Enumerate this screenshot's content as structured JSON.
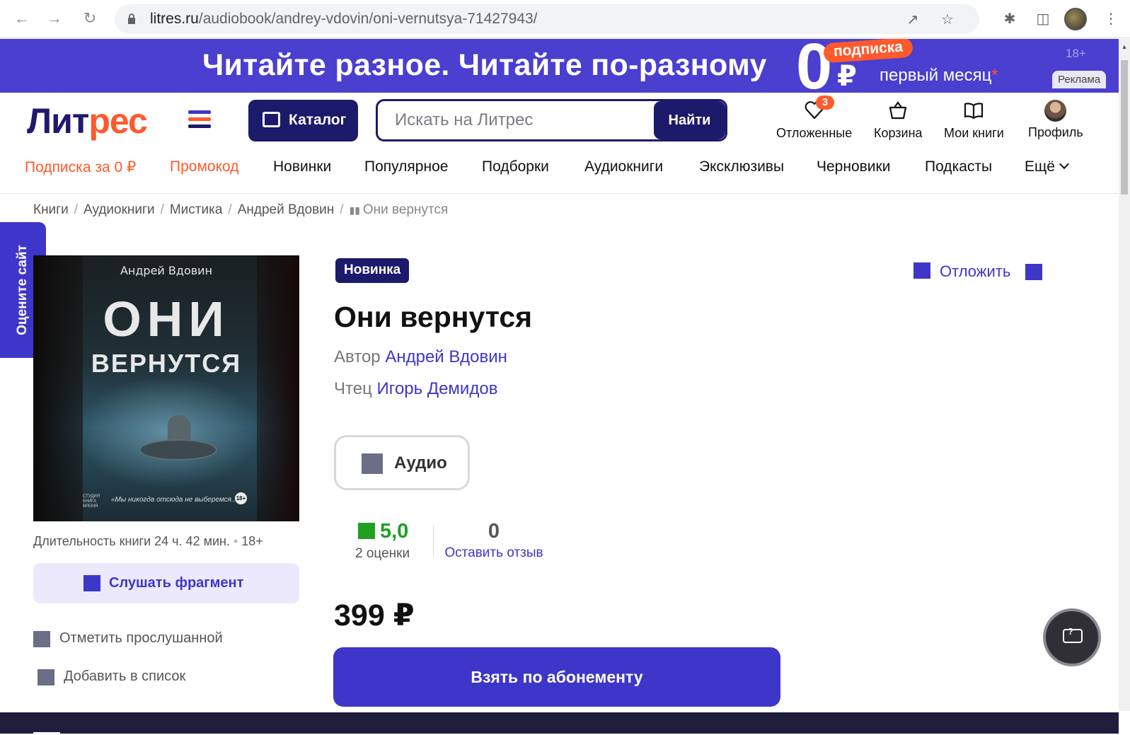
{
  "browser": {
    "url_host": "litres.ru",
    "url_path": "/audiobook/andrey-vdovin/oni-vernutsya-71427943/"
  },
  "ad": {
    "headline": "Читайте разное. Читайте по-разному",
    "zero": "0",
    "currency": "₽",
    "badge": "подписка",
    "month": "первый месяц",
    "asterisk": "*",
    "age": "18+",
    "label": "Реклама"
  },
  "header": {
    "logo_part1": "Лит",
    "logo_part2": "рес",
    "catalog": "Каталог",
    "search_placeholder": "Искать на Литрес",
    "search_button": "Найти",
    "favorites_label": "Отложенные",
    "favorites_count": "3",
    "cart_label": "Корзина",
    "mybooks_label": "Мои книги",
    "profile_label": "Профиль"
  },
  "menu": {
    "items": [
      "Подписка за 0 ₽",
      "Промокод",
      "Новинки",
      "Популярное",
      "Подборки",
      "Аудиокниги",
      "Эксклюзивы",
      "Черновики",
      "Подкасты",
      "Ещё"
    ]
  },
  "breadcrumbs": {
    "items": [
      "Книги",
      "Аудиокниги",
      "Мистика",
      "Андрей Вдовин"
    ],
    "current": "Они вернутся",
    "separator": "/"
  },
  "rate_tab": "Оцените сайт",
  "cover": {
    "author": "Андрей Вдовин",
    "title_line1": "ОНИ",
    "title_line2": "ВЕРНУТСЯ",
    "quote": "«Мы никогда отсюда не выберемся...»",
    "age": "18+",
    "publisher": "СТУДИЯ КНИГА ВРЕМЯ"
  },
  "book": {
    "duration": "Длительность книги 24 ч. 42 мин.",
    "age": "18+",
    "listen_fragment": "Слушать фрагмент",
    "mark_listened": "Отметить прослушанной",
    "add_to_list": "Добавить в список",
    "badge": "Новинка",
    "title": "Они вернутся",
    "author_label": "Автор",
    "author_name": "Андрей Вдовин",
    "reader_label": "Чтец",
    "reader_name": "Игорь Демидов",
    "postpone": "Отложить",
    "format": "Аудио",
    "rating": "5,0",
    "rating_count": "2 оценки",
    "reviews_count": "0",
    "leave_review": "Оставить отзыв",
    "price": "399 ₽",
    "subscribe_button": "Взять по абонементу"
  },
  "colors": {
    "brand_dark": "#1c1a6b",
    "brand": "#3e36c9",
    "accent": "#ff5a2c",
    "rating": "#1fa021"
  }
}
